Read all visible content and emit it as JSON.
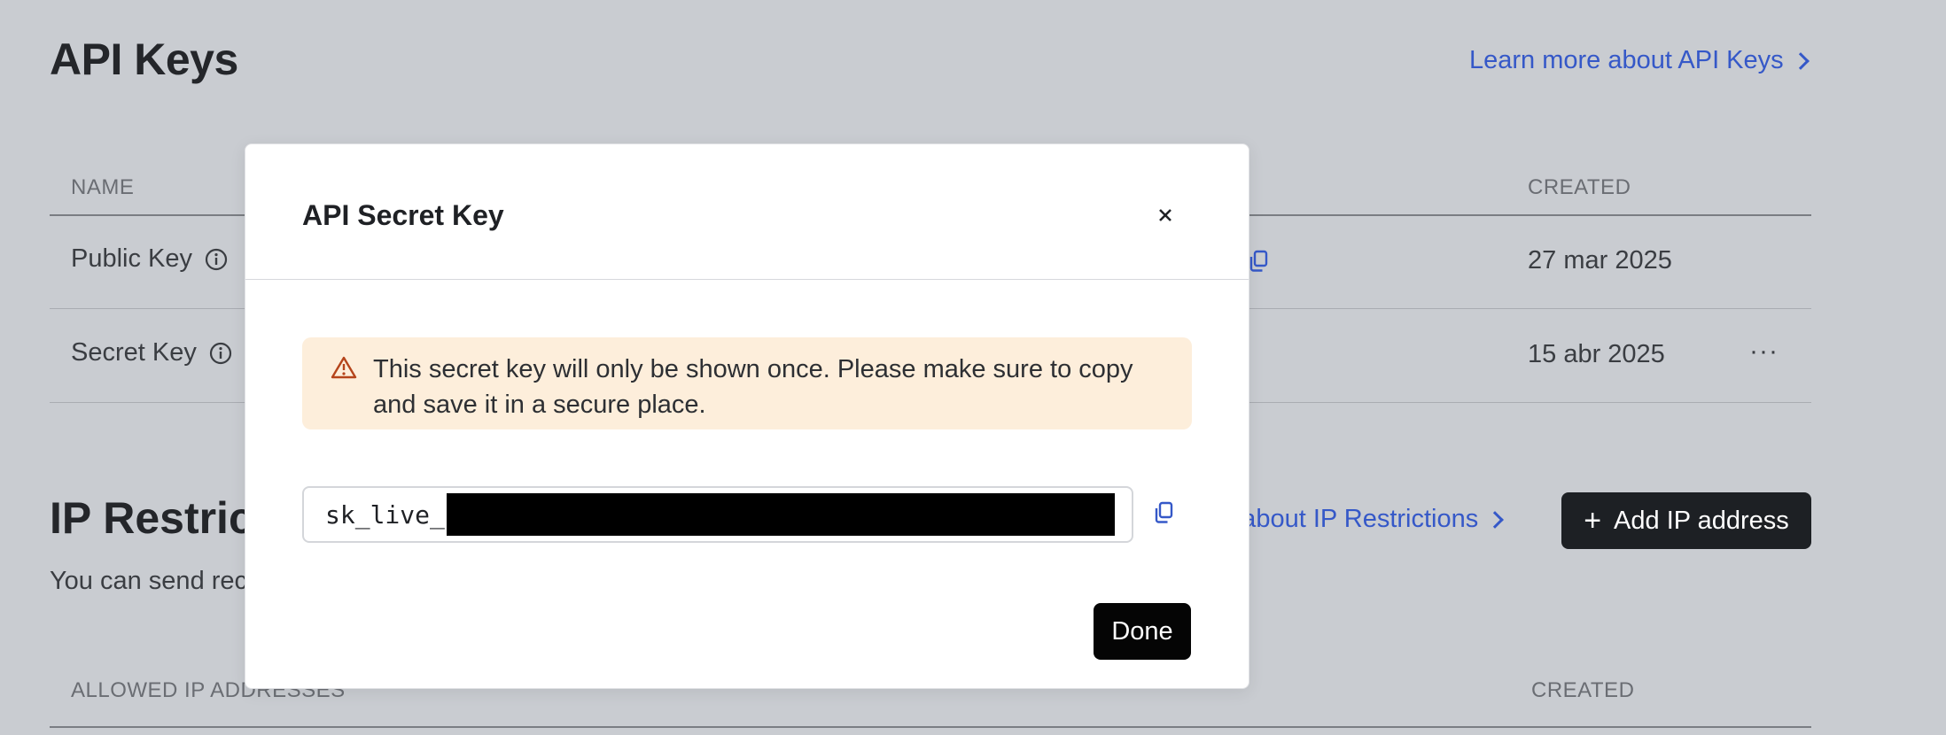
{
  "page": {
    "title": "API Keys",
    "learn_more_label": "Learn more about API Keys"
  },
  "keys_table": {
    "headers": {
      "name": "NAME",
      "created": "CREATED"
    },
    "rows": [
      {
        "name": "Public Key",
        "created": "27 mar 2025"
      },
      {
        "name": "Secret Key",
        "created": "15 abr 2025",
        "menu": "···"
      }
    ]
  },
  "ip_section": {
    "title": "IP Restric",
    "subtitle": "You can send rec",
    "learn_more_label": "e about IP Restrictions",
    "add_button_label": "Add IP address",
    "headers": {
      "allowed": "ALLOWED IP ADDRESSES",
      "created": "CREATED"
    }
  },
  "modal": {
    "title": "API Secret Key",
    "close_glyph": "×",
    "warning": "This secret key will only be shown once. Please make sure to copy and save it in a secure place.",
    "key_prefix": "sk_live_",
    "done_label": "Done"
  },
  "colors": {
    "overlay_background": "#c9ccd1",
    "link": "#3558c8",
    "warning_background": "#fdeedb",
    "warning_icon": "#b5441b",
    "primary_button": "#050505"
  },
  "icons": [
    "info-icon",
    "copy-icon",
    "warning-icon",
    "close-icon",
    "plus-icon",
    "chevron-right-icon",
    "more-icon"
  ]
}
